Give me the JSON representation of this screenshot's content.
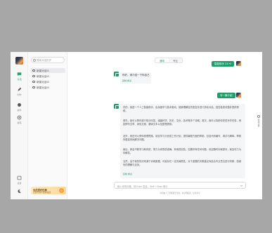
{
  "rail": {
    "items": [
      {
        "label": "对话",
        "icon": "chat-icon"
      },
      {
        "label": "创作",
        "icon": "pen-icon"
      },
      {
        "label": "插件",
        "icon": "plugin-icon"
      },
      {
        "label": "发现",
        "icon": "discover-icon"
      }
    ],
    "bottom": [
      {
        "label": "设置",
        "icon": "settings-icon"
      },
      {
        "label": "",
        "icon": "moon-icon"
      }
    ]
  },
  "sidebar": {
    "search_placeholder": "搜索对话历史",
    "conversations": [
      "新建对话01",
      "新建对话02",
      "新建对话03",
      "新建对话04"
    ],
    "promo": {
      "title": "会员限时优惠",
      "subtitle": "立即开通享更多权益"
    }
  },
  "main": {
    "tabs": [
      {
        "label": "通用",
        "active": true
      },
      {
        "label": "专业",
        "active": false
      }
    ],
    "pill_top": "智能助手 3.5 ⟲",
    "pill_mid": "写一篇介绍",
    "msg1": {
      "text": "你好，请介绍一下你自己",
      "meta": "复制  重试"
    },
    "msg2": {
      "paragraphs": [
        "好的，我是一个人工智能助手，由深度学习技术驱动，能够理解自然语言并进行多轮对话，回答各类问题并提供帮助。",
        "首先，我可以帮你进行知识问答，涵盖科学、历史、文化、技术等多个领域；其次，我可以协助你完成写作任务，例如撰写文章、润色文案、翻译文本以及整理提纲。",
        "此外，我还可以帮你梳理思路，制定学习计划或工作计划，提供编程方面的帮助，包括代码编写、调试与解释，帮助你更高效地解决问题。",
        "最后，我会不断学习和改进，努力为你提供准确、有用的回答。如果你有任何问题，欢迎随时向我提问，我会尽力为你解答。",
        "当然，由于我的知识来源于训练数据，可能存在一定的局限性，对于重要的决策建议你结合专业意见进行判断，感谢你的理解与支持。"
      ],
      "meta": "复制  重试"
    },
    "side_tool_label": "会话记录",
    "input_placeholder": "输入你的问题，按 Enter 发送，Shift + Enter 换行",
    "footer": "内容由人工智能模型生成，请仔细甄别，仅供参考"
  },
  "colors": {
    "accent": "#1f9d6b",
    "background": "#a7a7a7",
    "promo": "#fbd89a"
  }
}
